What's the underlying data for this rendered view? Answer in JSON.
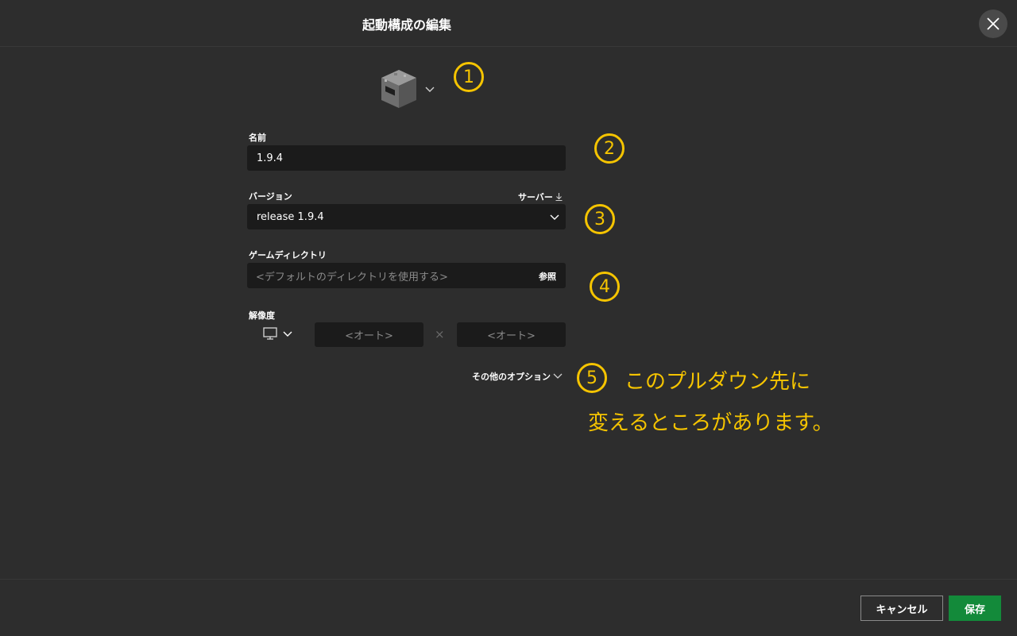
{
  "header": {
    "title": "起動構成の編集"
  },
  "icon": {
    "name": "furnace-block-icon"
  },
  "name_field": {
    "label": "名前",
    "value": "1.9.4"
  },
  "version_field": {
    "label": "バージョン",
    "server_link": "サーバー",
    "value": "release 1.9.4"
  },
  "directory_field": {
    "label": "ゲームディレクトリ",
    "placeholder": "<デフォルトのディレクトリを使用する>",
    "browse": "参照"
  },
  "resolution": {
    "label": "解像度",
    "width_placeholder": "<オート>",
    "height_placeholder": "<オート>",
    "separator": "×"
  },
  "more_options": {
    "label": "その他のオプション"
  },
  "footer": {
    "cancel": "キャンセル",
    "save": "保存"
  },
  "annotations": {
    "num1": "1",
    "num2": "2",
    "num3": "3",
    "num4": "4",
    "num5": "5",
    "note_line1": "このプルダウン先に",
    "note_line2": "変えるところがあります。"
  },
  "colors": {
    "background": "#2d2d2d",
    "input": "#1b1b1b",
    "accent_green": "#138a3a",
    "annotation": "#f5c400"
  }
}
